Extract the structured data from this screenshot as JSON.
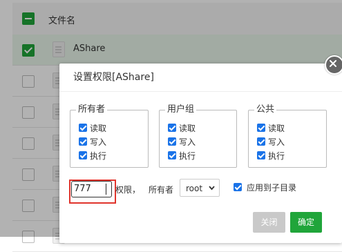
{
  "file_list": {
    "header": {
      "name_label": "文件名"
    },
    "rows": [
      {
        "name": "AShare",
        "selected": true
      },
      {
        "name": "",
        "selected": false
      },
      {
        "name": "",
        "selected": false
      },
      {
        "name": "",
        "selected": false
      },
      {
        "name": "",
        "selected": false
      },
      {
        "name": "",
        "selected": false
      },
      {
        "name": "",
        "selected": false
      }
    ]
  },
  "dialog": {
    "title": "设置权限[AShare]",
    "groups": [
      {
        "legend": "所有者",
        "perms": [
          {
            "label": "读取",
            "checked": true
          },
          {
            "label": "写入",
            "checked": true
          },
          {
            "label": "执行",
            "checked": true
          }
        ]
      },
      {
        "legend": "用户组",
        "perms": [
          {
            "label": "读取",
            "checked": true
          },
          {
            "label": "写入",
            "checked": true
          },
          {
            "label": "执行",
            "checked": true
          }
        ]
      },
      {
        "legend": "公共",
        "perms": [
          {
            "label": "读取",
            "checked": true
          },
          {
            "label": "写入",
            "checked": true
          },
          {
            "label": "执行",
            "checked": true
          }
        ]
      }
    ],
    "permission_value": "777",
    "permission_suffix": "权限，",
    "owner_label": "所有者",
    "owner_value": "root",
    "apply_subdirs_label": "应用到子目录",
    "apply_subdirs_checked": true,
    "close_label": "关闭",
    "confirm_label": "确定"
  },
  "colors": {
    "accent_green": "#20a53a",
    "checkbox_blue": "#1a73e8",
    "highlight_red": "#e0342c"
  }
}
